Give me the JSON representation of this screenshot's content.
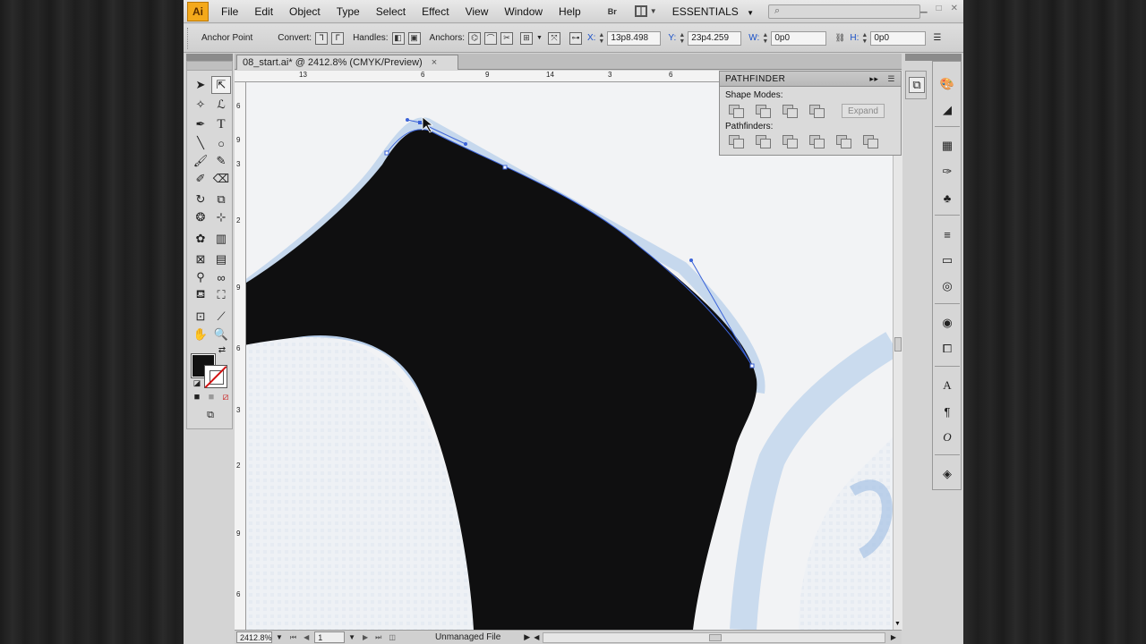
{
  "menubar": {
    "logo": "Ai",
    "items": [
      "File",
      "Edit",
      "Object",
      "Type",
      "Select",
      "Effect",
      "View",
      "Window",
      "Help"
    ],
    "bridge_label": "Br",
    "workspace": "ESSENTIALS",
    "search_placeholder": ""
  },
  "controlbar": {
    "anchor_point": "Anchor Point",
    "convert": "Convert:",
    "handles": "Handles:",
    "anchors": "Anchors:",
    "x_label": "X:",
    "x_value": "13p8.498",
    "y_label": "Y:",
    "y_value": "23p4.259",
    "w_label": "W:",
    "w_value": "0p0",
    "h_label": "H:",
    "h_value": "0p0"
  },
  "document": {
    "tab_title": "08_start.ai* @ 2412.8% (CMYK/Preview)",
    "close": "×"
  },
  "rulers": {
    "top": [
      "13",
      "6",
      "9",
      "14",
      "3",
      "6"
    ],
    "left": [
      "6",
      "9",
      "3",
      "2",
      "9",
      "6",
      "3",
      "2",
      "9",
      "6"
    ]
  },
  "pathfinder": {
    "title": "PATHFINDER",
    "shape_modes_label": "Shape Modes:",
    "expand_label": "Expand",
    "pathfinders_label": "Pathfinders:"
  },
  "statusbar": {
    "zoom": "2412.8%",
    "artboard": "1",
    "status": "Unmanaged File"
  },
  "colors": {
    "fill": "#111111",
    "stroke_none": "#d21010",
    "selection": "#3a62d8",
    "trace_blue": "#a9c6e8"
  }
}
